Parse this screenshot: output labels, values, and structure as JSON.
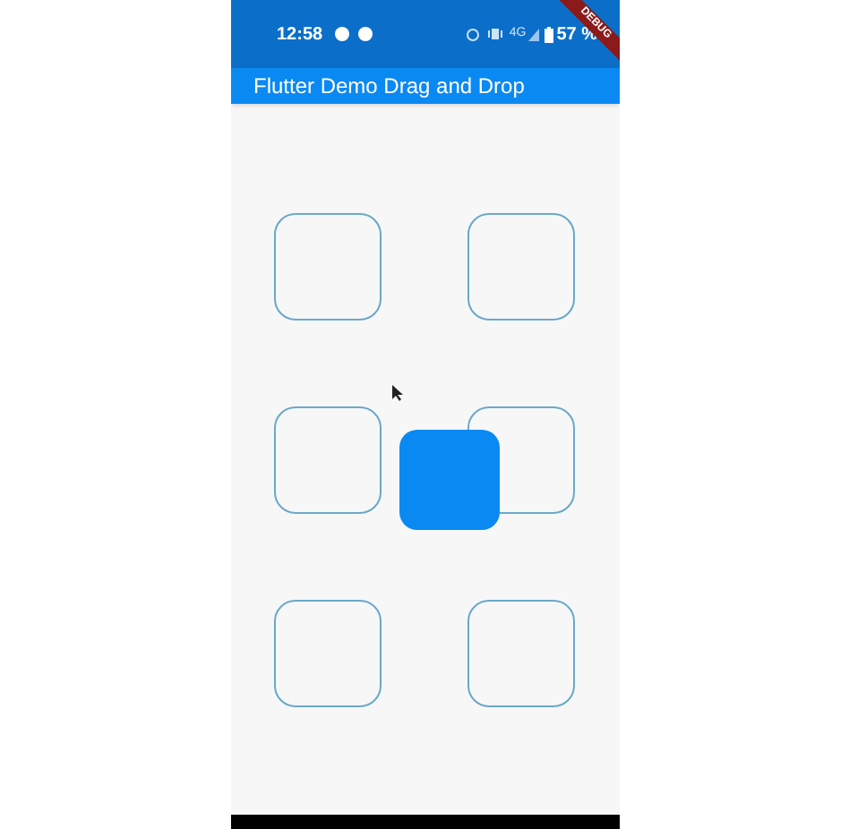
{
  "status_bar": {
    "time": "12:58",
    "network": "4G",
    "battery": "57 %"
  },
  "debug_banner": "DEBUG",
  "app_bar": {
    "title": "Flutter Demo Drag and Drop"
  },
  "targets": [
    {
      "filled": false
    },
    {
      "filled": false
    },
    {
      "filled": false
    },
    {
      "filled": false
    },
    {
      "filled": false
    },
    {
      "filled": false
    }
  ],
  "dragged_tile": {
    "dragging": true
  }
}
